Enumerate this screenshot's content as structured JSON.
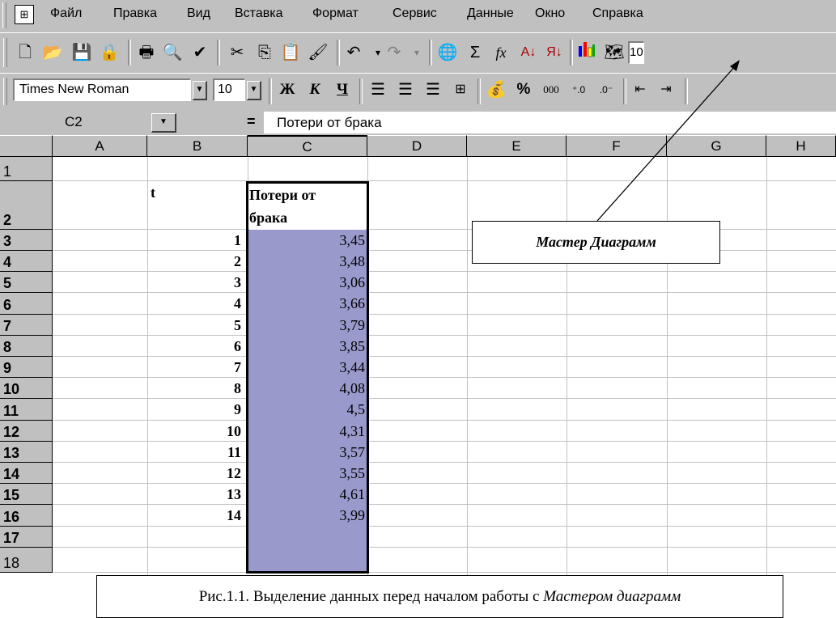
{
  "menu": {
    "items": [
      {
        "label": "Файл"
      },
      {
        "label": "Правка"
      },
      {
        "label": "Вид"
      },
      {
        "label": "Вставка"
      },
      {
        "label": "Формат"
      },
      {
        "label": "Сервис"
      },
      {
        "label": "Данные"
      },
      {
        "label": "Окно"
      },
      {
        "label": "Справка"
      }
    ]
  },
  "toolbar1": {
    "icons": [
      "new-icon",
      "open-icon",
      "save-icon",
      "lock-icon",
      "print-icon",
      "preview-icon",
      "spelling-icon",
      "cut-icon",
      "copy-icon",
      "paste-icon",
      "format-painter-icon",
      "undo-icon",
      "redo-icon",
      "web-icon",
      "autosum-icon",
      "function-icon",
      "sort-asc-icon",
      "sort-desc-icon",
      "chart-wizard-icon",
      "map-icon"
    ],
    "zoom_partial": "10"
  },
  "toolbar2": {
    "font_name": "Times New Roman",
    "font_size": "10",
    "bold_label": "Ж",
    "italic_label": "К",
    "underline_label": "Ч",
    "percent_label": "%",
    "thousands_label": "000"
  },
  "formula_bar": {
    "cell_ref": "C2",
    "equals": "=",
    "content": "Потери от брака"
  },
  "columns": [
    "A",
    "B",
    "C",
    "D",
    "E",
    "F",
    "G",
    "H"
  ],
  "rows": [
    "1",
    "2",
    "3",
    "4",
    "5",
    "6",
    "7",
    "8",
    "9",
    "10",
    "11",
    "12",
    "13",
    "14",
    "15",
    "16",
    "17",
    "18"
  ],
  "header_cells": {
    "b2": "t",
    "c2_line1": "Потери от",
    "c2_line2": "брака"
  },
  "data": [
    {
      "t": "1",
      "v": "3,45"
    },
    {
      "t": "2",
      "v": "3,48"
    },
    {
      "t": "3",
      "v": "3,06"
    },
    {
      "t": "4",
      "v": "3,66"
    },
    {
      "t": "5",
      "v": "3,79"
    },
    {
      "t": "6",
      "v": "3,85"
    },
    {
      "t": "7",
      "v": "3,44"
    },
    {
      "t": "8",
      "v": "4,08"
    },
    {
      "t": "9",
      "v": "4,5"
    },
    {
      "t": "10",
      "v": "4,31"
    },
    {
      "t": "11",
      "v": "3,57"
    },
    {
      "t": "12",
      "v": "3,55"
    },
    {
      "t": "13",
      "v": "4,61"
    },
    {
      "t": "14",
      "v": "3,99"
    }
  ],
  "callout": "Мастер Диаграмм",
  "caption": {
    "prefix": "Рис.1.1. Выделение данных перед началом работы с ",
    "italic": "Мастером диаграмм"
  }
}
